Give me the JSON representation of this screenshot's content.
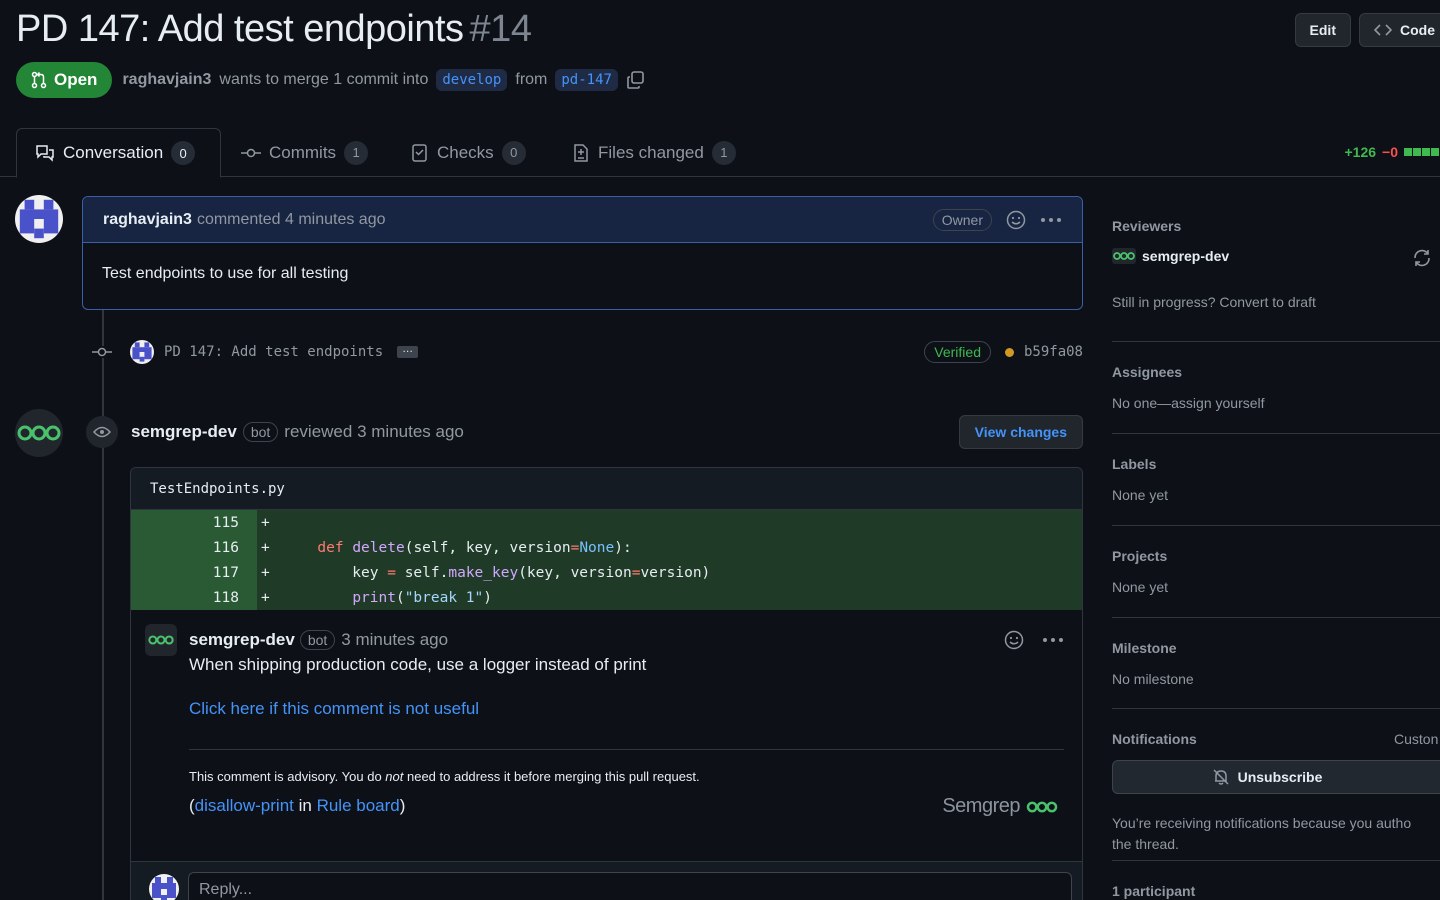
{
  "pr": {
    "title": "PD 147: Add test endpoints",
    "number": "#14",
    "state": "Open",
    "author": "raghavjain3",
    "merge_text": "wants to merge 1 commit into",
    "base_branch": "develop",
    "from_text": "from",
    "head_branch": "pd-147"
  },
  "header_buttons": {
    "edit": "Edit",
    "code": "Code"
  },
  "tabs": [
    {
      "label": "Conversation",
      "count": "0"
    },
    {
      "label": "Commits",
      "count": "1"
    },
    {
      "label": "Checks",
      "count": "0"
    },
    {
      "label": "Files changed",
      "count": "1"
    }
  ],
  "diffstat": {
    "additions": "+126",
    "deletions": "−0"
  },
  "first_comment": {
    "author": "raghavjain3",
    "action": "commented",
    "time": "4 minutes ago",
    "badge": "Owner",
    "body": "Test endpoints to use for all testing"
  },
  "commit": {
    "message": "PD 147: Add test endpoints",
    "ellipsis": "…",
    "verified": "Verified",
    "sha": "b59fa08"
  },
  "review": {
    "author": "semgrep-dev",
    "bot": "bot",
    "action": "reviewed",
    "time": "3 minutes ago",
    "view_changes": "View changes",
    "file": "TestEndpoints.py",
    "diff_lines": [
      {
        "num": "115",
        "sign": "+",
        "code": ""
      },
      {
        "num": "116",
        "sign": "+",
        "code": "    def delete(self, key, version=None):"
      },
      {
        "num": "117",
        "sign": "+",
        "code": "        key = self.make_key(key, version=version)"
      },
      {
        "num": "118",
        "sign": "+",
        "code": "        print(\"break 1\")"
      }
    ]
  },
  "inline_comment": {
    "author": "semgrep-dev",
    "bot": "bot",
    "time": "3 minutes ago",
    "text": "When shipping production code, use a logger instead of print",
    "link": "Click here if this comment is not useful",
    "advisory_pre": "This comment is advisory. You do ",
    "advisory_em": "not",
    "advisory_post": " need to address it before merging this pull request.",
    "rule_open": "(",
    "rule_name": "disallow-print",
    "rule_in": " in ",
    "rule_board": "Rule board",
    "rule_close": ")",
    "logo_text": "Semgrep",
    "reply_placeholder": "Reply..."
  },
  "sidebar": {
    "reviewers": {
      "title": "Reviewers",
      "name": "semgrep-dev",
      "draft": "Still in progress? Convert to draft"
    },
    "assignees": {
      "title": "Assignees",
      "value": "No one—assign yourself"
    },
    "labels": {
      "title": "Labels",
      "value": "None yet"
    },
    "projects": {
      "title": "Projects",
      "value": "None yet"
    },
    "milestone": {
      "title": "Milestone",
      "value": "No milestone"
    },
    "notifications": {
      "title": "Notifications",
      "customize": "Custon",
      "button": "Unsubscribe",
      "note_line1": "You’re receiving notifications because you autho",
      "note_line2": "the thread."
    },
    "participants": {
      "title": "1 participant"
    }
  },
  "colors": {
    "accent": "#4493f8",
    "open_green": "#238636",
    "diff_add_bg": "#1f3a26",
    "highlight_border": "#3b5ea8"
  }
}
